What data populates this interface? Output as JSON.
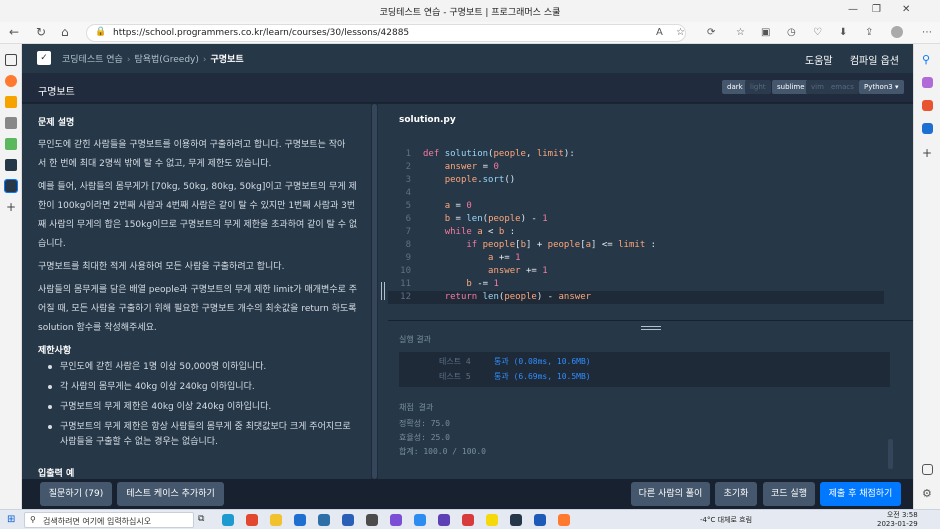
{
  "browser": {
    "tab_title": "코딩테스트 연습 - 구명보트 | 프로그래머스 스쿨",
    "url": "https://school.programmers.co.kr/learn/courses/30/lessons/42885"
  },
  "header": {
    "breadcrumbs": [
      "코딩테스트 연습",
      "탐욕법(Greedy)",
      "구명보트"
    ],
    "help_label": "도움말",
    "options_label": "컴파일 옵션"
  },
  "subheader": {
    "title": "구명보트",
    "theme_toggles": [
      "dark",
      "light"
    ],
    "keymap_toggles": [
      "sublime",
      "vim",
      "emacs"
    ],
    "language": "Python3"
  },
  "problem": {
    "section_title": "문제 설명",
    "p1_line1": "무인도에 갇힌 사람들을 구명보트를 이용하여 구출하려고 합니다. 구명보트는 작아",
    "p1_line2": "서 한 번에 최대 2명씩 밖에 탈 수 없고, 무게 제한도 있습니다.",
    "p2_line1": "예를 들어, 사람들의 몸무게가 [70kg, 50kg, 80kg, 50kg]이고 구명보트의 무게 제",
    "p2_line2": "한이 100kg이라면 2번째 사람과 4번째 사람은 같이 탈 수 있지만 1번째 사람과 3번",
    "p2_line3": "째 사람의 무게의 합은 150kg이므로 구명보트의 무게 제한을 초과하여 같이 탈 수 없",
    "p2_line4": "습니다.",
    "p3": "구명보트를 최대한 적게 사용하여 모든 사람을 구출하려고 합니다.",
    "p4_line1": "사람들의 몸무게를 담은 배열 people과 구명보트의 무게 제한 limit가 매개변수로 주",
    "p4_line2": "어질 때, 모든 사람을 구출하기 위해 필요한 구명보트 개수의 최솟값을 return 하도록",
    "p4_line3": "solution 함수를 작성해주세요.",
    "constraints_title": "제한사항",
    "constraints": [
      "무인도에 갇힌 사람은 1명 이상 50,000명 이하입니다.",
      "각 사람의 몸무게는 40kg 이상 240kg 이하입니다.",
      "구명보트의 무게 제한은 40kg 이상 240kg 이하입니다.",
      "구명보트의 무게 제한은 항상 사람들의 몸무게 중 최댓값보다 크게 주어지므로",
      "사람들을 구출할 수 없는 경우는 없습니다."
    ],
    "io_title": "입출력 예"
  },
  "editor": {
    "filename": "solution.py",
    "line_numbers": [
      "1",
      "2",
      "3",
      "4",
      "5",
      "6",
      "7",
      "8",
      "9",
      "10",
      "11",
      "12"
    ]
  },
  "result": {
    "title": "실행 결과",
    "tests": [
      {
        "name": "테스트 4",
        "result": "통과 (0.08ms, 10.6MB)"
      },
      {
        "name": "테스트 5",
        "result": "통과 (6.69ms, 10.5MB)"
      }
    ],
    "summary_title": "채점 결과",
    "accuracy": "정확성: 75.0",
    "efficiency": "효율성: 25.0",
    "total": "합계: 100.0 / 100.0"
  },
  "footer": {
    "ask_label": "질문하기 (79)",
    "add_test_label": "테스트 케이스 추가하기",
    "others_label": "다른 사람의 풀이",
    "reset_label": "초기화",
    "run_label": "코드 실행",
    "submit_label": "제출 후 채점하기"
  },
  "taskbar": {
    "search_placeholder": "검색하려면 여기에 입력하십시오",
    "weather": "-4°C 대체로 흐림",
    "time": "오전 3:58",
    "date": "2023-01-29"
  },
  "colors": {
    "accent": "#0078ff",
    "pass": "#2f8dff",
    "keyword": "#f57aa0"
  }
}
